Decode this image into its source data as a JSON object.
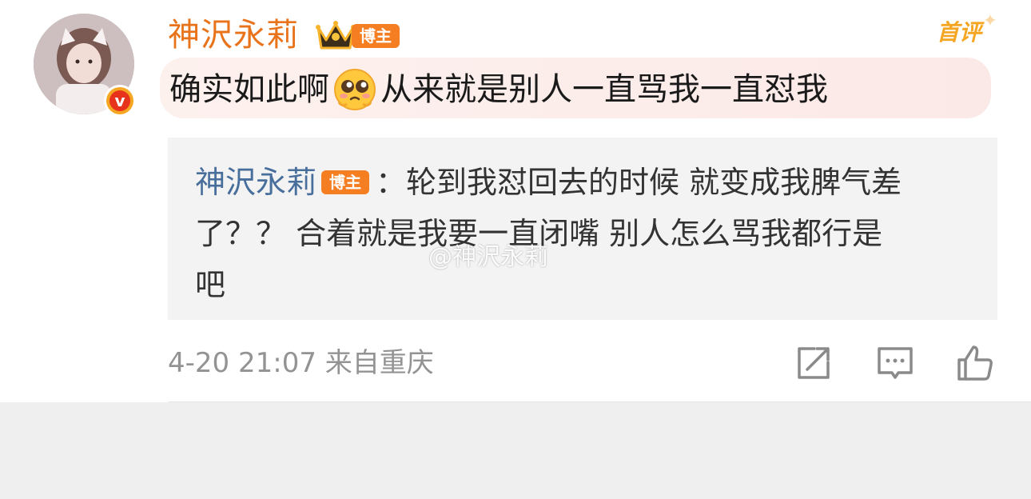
{
  "comment": {
    "username": "神沢永莉",
    "badge": "博主",
    "top_label": "首评",
    "text_before_emoji": "确实如此啊",
    "emoji_icon": "pleading-face-emoji",
    "text_after_emoji": "从来就是别人一直骂我一直怼我",
    "quote": {
      "username": "神沢永莉",
      "badge": "博主",
      "line1": "：轮到我怼回去的时候 就变成我脾气差",
      "line2": "了？？ 合着就是我要一直闭嘴 别人怎么骂我都行是",
      "line3": "吧"
    },
    "watermark": "@神沢永莉",
    "timestamp": "4-20 21:07",
    "location": "来自重庆",
    "actions": [
      "share-icon",
      "comment-icon",
      "like-icon"
    ]
  },
  "colors": {
    "username": "#e8731b",
    "badge_bg": "#f57d22",
    "quote_username": "#486e9c",
    "meta": "#939393"
  }
}
